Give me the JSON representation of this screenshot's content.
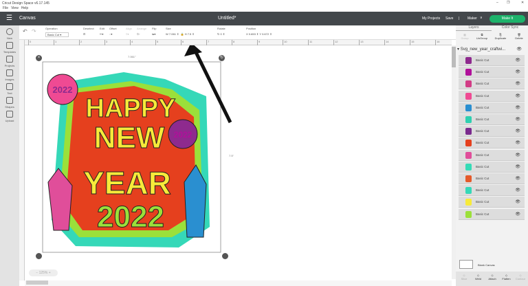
{
  "window": {
    "title": "Cricut Design Space  v6.17.145",
    "minimize": "–",
    "restore": "❐",
    "close": "✕"
  },
  "menu": [
    "File",
    "View",
    "Help"
  ],
  "header": {
    "menu_icon": "☰",
    "section": "Canvas",
    "doc_title": "Untitled*",
    "my_projects": "My Projects",
    "save": "Save",
    "separator": "|",
    "machine": "Maker",
    "chevron": "∨",
    "make_it": "Make It",
    "accent": "#1db36b"
  },
  "sidebar": [
    {
      "label": "New",
      "icon": "plus-circle-icon"
    },
    {
      "label": "Templates",
      "icon": "shirt-icon"
    },
    {
      "label": "Projects",
      "icon": "notebook-icon"
    },
    {
      "label": "Images",
      "icon": "image-icon"
    },
    {
      "label": "Text",
      "icon": "text-icon"
    },
    {
      "label": "Shapes",
      "icon": "shapes-icon"
    },
    {
      "label": "Upload",
      "icon": "upload-icon"
    }
  ],
  "toolbar": {
    "undo": "↶",
    "redo": "↷",
    "operation_label": "Operation",
    "operation_value": "Basic Cut",
    "deselect": "Deselect",
    "edit": "Edit",
    "offset": "Offset",
    "align": "Align",
    "arrange": "Arrange",
    "flip": "Flip",
    "size": "Size",
    "w_label": "W",
    "w_value": "7.061",
    "h_label": "H",
    "h_value": "7.5",
    "rotate": "Rotate",
    "rotate_value": "0",
    "position": "Position",
    "x_label": "X",
    "x_value": "0.653",
    "y_label": "Y",
    "y_value": "0.672"
  },
  "ruler": [
    "0",
    "1",
    "2",
    "3",
    "4",
    "5",
    "6",
    "7",
    "8",
    "9",
    "10",
    "11",
    "12",
    "13",
    "14",
    "15",
    "16"
  ],
  "canvas": {
    "width_label": "7.061\"",
    "height_label": "7.5\"",
    "zoom": "125%",
    "zoom_minus": "−",
    "zoom_plus": "+",
    "art": {
      "line1": "HAPPY",
      "line2": "NEW",
      "line3": "YEAR",
      "line4": "2022",
      "balloon": "2022"
    }
  },
  "panel": {
    "tabs": [
      "Layers",
      "Color Sync"
    ],
    "actions": [
      "Group",
      "UnGroup",
      "Duplicate",
      "Delete"
    ],
    "group_name": "Svg_new_year_craftwi...",
    "layers": [
      {
        "label": "Basic Cut",
        "color": "#8e2a8e"
      },
      {
        "label": "Basic Cut",
        "color": "#b0109a"
      },
      {
        "label": "Basic Cut",
        "color": "#d23c86"
      },
      {
        "label": "Basic Cut",
        "color": "#ef4a93"
      },
      {
        "label": "Basic Cut",
        "color": "#2a8fd0"
      },
      {
        "label": "Basic Cut",
        "color": "#2fd0b0"
      },
      {
        "label": "Basic Cut",
        "color": "#7a2a8e"
      },
      {
        "label": "Basic Cut",
        "color": "#e5401e"
      },
      {
        "label": "Basic Cut",
        "color": "#e04e9a"
      },
      {
        "label": "Basic Cut",
        "color": "#35dbb6"
      },
      {
        "label": "Basic Cut",
        "color": "#e55a2a"
      },
      {
        "label": "Basic Cut",
        "color": "#35d8b8"
      },
      {
        "label": "Basic Cut",
        "color": "#f7ea3a"
      },
      {
        "label": "Basic Cut",
        "color": "#9be03a"
      }
    ],
    "blank_canvas": "Blank Canvas",
    "bottom_actions": [
      "Slice",
      "Weld",
      "Attach",
      "Flatten",
      "Contour"
    ]
  }
}
